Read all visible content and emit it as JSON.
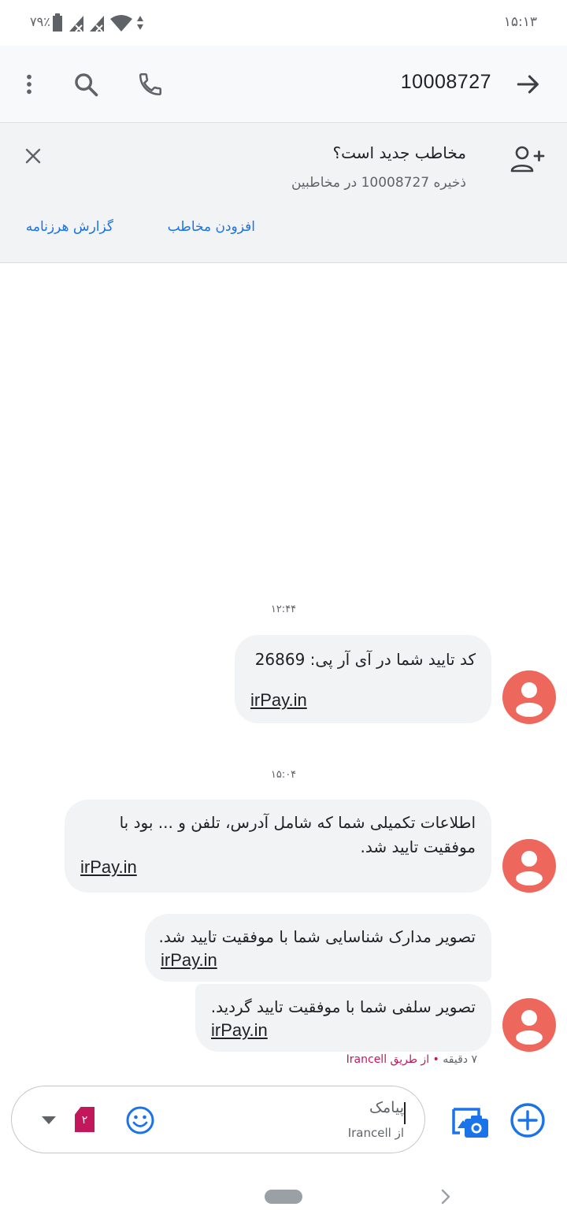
{
  "status_bar": {
    "time": "۱۵:۱۳",
    "battery_percent": "۷۹٪",
    "icons": [
      "battery-icon",
      "no-signal-sim1-icon",
      "no-signal-sim2-icon",
      "wifi-icon",
      "data-arrows-icon"
    ]
  },
  "app_bar": {
    "title": "10008727",
    "icons": [
      "more-vert-icon",
      "search-icon",
      "phone-icon",
      "back-arrow-icon"
    ]
  },
  "banner": {
    "title": "مخاطب جدید است؟",
    "subtitle": "ذخیره 10008727 در مخاطبین",
    "add_contact_label": "افزودن مخاطب",
    "report_spam_label": "گزارش هرزنامه",
    "icons": [
      "close-icon",
      "add-person-icon"
    ]
  },
  "messages": [
    {
      "timestamp": "۱۲:۴۴",
      "lines": [
        "کد تایید شما در آی آر پی: 26869"
      ],
      "link": "irPay.in"
    },
    {
      "timestamp": "۱۵:۰۴",
      "lines": [
        "اطلاعات تکمیلی شما که شامل آدرس، تلفن و ... بود با",
        "موفقیت تایید شد."
      ],
      "link": "irPay.in"
    },
    {
      "lines": [
        "تصویر مدارک شناسایی شما با موفقیت تایید شد."
      ],
      "link": "irPay.in"
    },
    {
      "lines": [
        "تصویر سلفی شما با موفقیت تایید گردید."
      ],
      "link": "irPay.in"
    }
  ],
  "message_meta": {
    "time_ago": "۷ دقیقه",
    "separator": "•",
    "via": "از طریق Irancell"
  },
  "composer": {
    "placeholder": "پیامک",
    "sim_label": "از Irancell",
    "sim_badge": "۲",
    "icons": [
      "dropdown-icon",
      "sim-card-icon",
      "emoji-icon",
      "gallery-camera-icon",
      "add-circle-icon"
    ]
  },
  "colors": {
    "accent": "#1a73e8",
    "avatar": "#ee675c",
    "sim": "#c2185b",
    "bubble": "#f1f3f4"
  }
}
